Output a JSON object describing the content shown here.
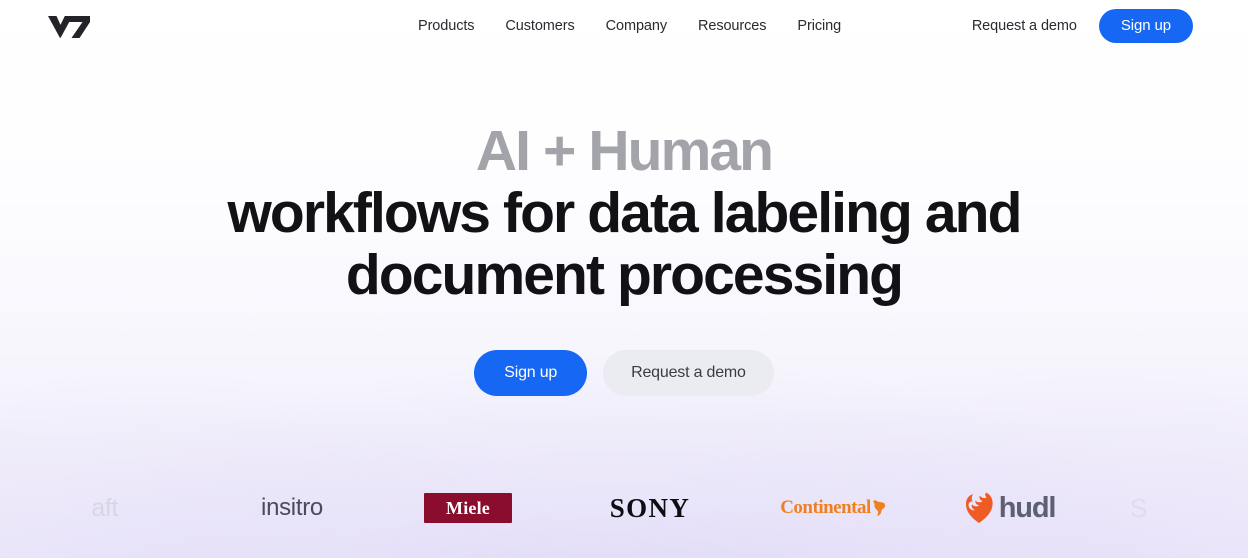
{
  "brand": {
    "logo_text": "V7",
    "logo_icon": "v7-wordmark-icon"
  },
  "header": {
    "nav": [
      {
        "label": "Products"
      },
      {
        "label": "Customers"
      },
      {
        "label": "Company"
      },
      {
        "label": "Resources"
      },
      {
        "label": "Pricing"
      }
    ],
    "demo_link": "Request a demo",
    "signup_label": "Sign up",
    "signup_color": "#1667f3"
  },
  "hero": {
    "headline_muted": "AI + Human",
    "headline_line2": "workflows for data labeling and",
    "headline_line3": "document processing",
    "muted_color": "#a3a3aa",
    "text_color": "#111116",
    "primary_cta": "Sign up",
    "secondary_cta": "Request a demo",
    "primary_cta_color": "#1667f3",
    "secondary_cta_color": "#ebecf2"
  },
  "logo_strip": {
    "logos": [
      {
        "name": "microsoft",
        "text": "aft",
        "color": "#c9cad6",
        "clipped": true
      },
      {
        "name": "insitro",
        "text": "insitro",
        "color": "#4a4b58"
      },
      {
        "name": "miele",
        "text": "Miele",
        "color": "#ffffff",
        "background": "#8a0d2e"
      },
      {
        "name": "sony",
        "text": "SONY",
        "color": "#0d0d14"
      },
      {
        "name": "continental",
        "text": "Continental",
        "color": "#ef8022"
      },
      {
        "name": "hudl",
        "text": "hudl",
        "color": "#5d6073",
        "mark_color": "#ee5b25"
      },
      {
        "name": "partial-right",
        "text": "S",
        "color": "#ddd9ef",
        "clipped": true
      }
    ]
  }
}
